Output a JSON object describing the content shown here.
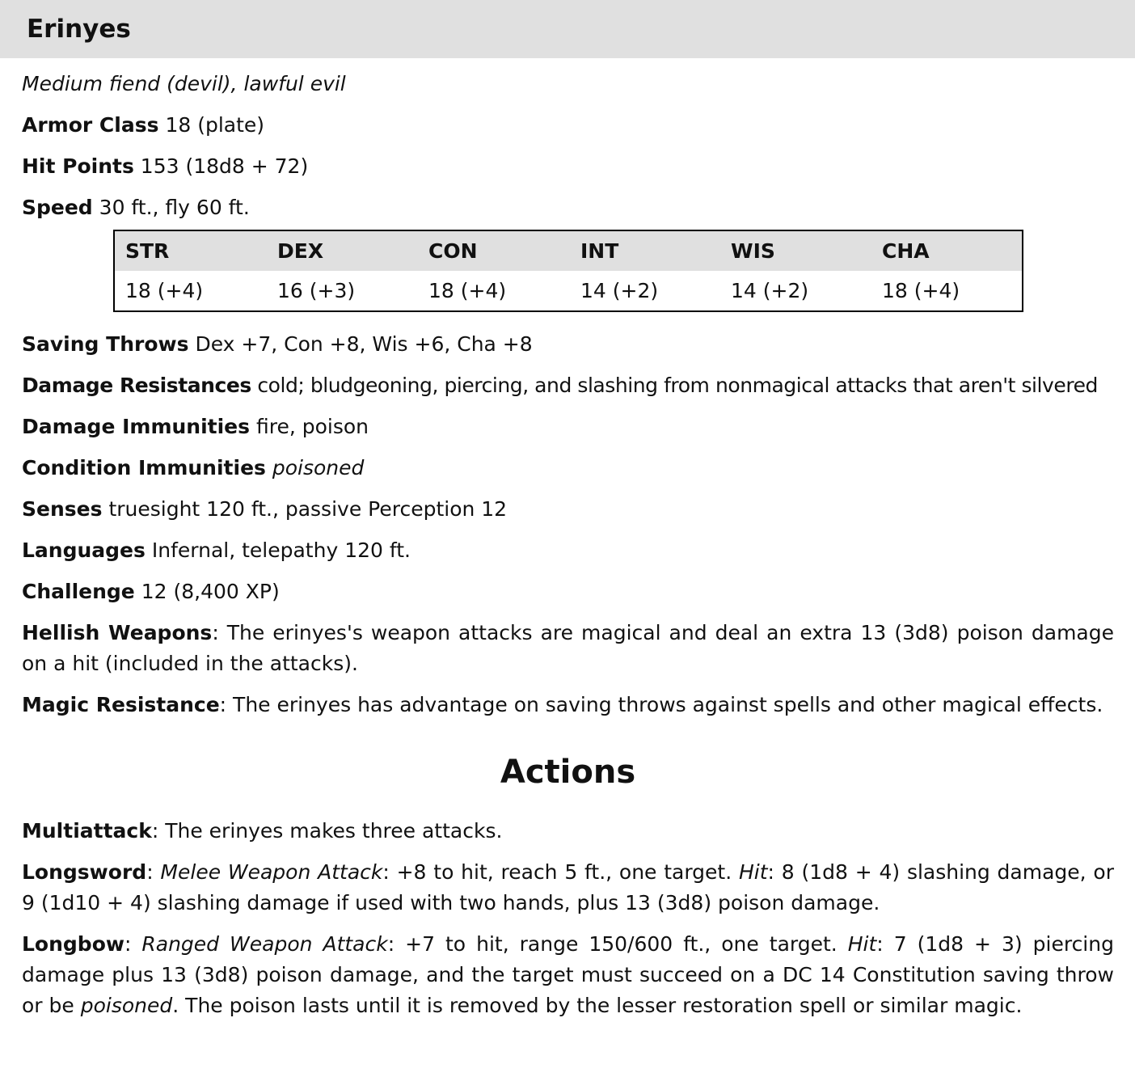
{
  "creature": {
    "name": "Erinyes",
    "type_line": "Medium fiend (devil), lawful evil"
  },
  "basics": [
    {
      "label": "Armor Class",
      "value": "18 (plate)"
    },
    {
      "label": "Hit Points",
      "value": "153 (18d8 + 72)"
    },
    {
      "label": "Speed",
      "value": "30 ft., fly 60 ft."
    }
  ],
  "abilities": {
    "headers": [
      "STR",
      "DEX",
      "CON",
      "INT",
      "WIS",
      "CHA"
    ],
    "values": [
      "18 (+4)",
      "16 (+3)",
      "18 (+4)",
      "14 (+2)",
      "14 (+2)",
      "18 (+4)"
    ]
  },
  "properties": {
    "saving_throws": {
      "label": "Saving Throws",
      "value": "Dex +7, Con +8, Wis +6, Cha +8"
    },
    "damage_resistances": {
      "label": "Damage Resistances",
      "value": "cold; bludgeoning, piercing, and slashing from nonmagical attacks that aren't silvered"
    },
    "damage_immunities": {
      "label": "Damage Immunities",
      "value": "fire, poison"
    },
    "condition_immunities": {
      "label": "Condition Immunities",
      "value": "poisoned"
    },
    "senses": {
      "label": "Senses",
      "value": "truesight 120 ft., passive Perception 12"
    },
    "languages": {
      "label": "Languages",
      "value": "Infernal, telepathy 120 ft."
    },
    "challenge": {
      "label": "Challenge",
      "value": "12 (8,400 XP)"
    }
  },
  "traits": {
    "hellish_weapons": {
      "name": "Hellish Weapons",
      "text": "The erinyes's weapon attacks are magical and deal an extra 13 (3d8) poison damage on a hit (included in the attacks)."
    },
    "magic_resistance": {
      "name": "Magic Resistance",
      "text": "The erinyes has advantage on saving throws against spells and other magical effects."
    }
  },
  "actions_heading": "Actions",
  "actions": {
    "multiattack": {
      "name": "Multiattack",
      "text": "The erinyes makes three attacks."
    },
    "longsword": {
      "name": "Longsword",
      "attack_type": "Melee Weapon Attack",
      "attack_text": "+8 to hit, reach 5 ft., one target.",
      "hit_label": "Hit",
      "hit_text": "8 (1d8 + 4) slashing damage, or 9 (1d10 + 4) slashing damage if used with two hands, plus 13 (3d8) poison damage."
    },
    "longbow": {
      "name": "Longbow",
      "attack_type": "Ranged Weapon Attack",
      "attack_text": "+7 to hit, range 150/600 ft., one target.",
      "hit_label": "Hit",
      "hit_text_1": "7 (1d8 + 3) piercing damage plus 13 (3d8) poison damage, and the target must succeed on a DC 14 Constitution saving throw or be",
      "condition": "poisoned",
      "hit_text_2": "The poison lasts until it is removed by the lesser restoration spell or similar magic."
    }
  }
}
